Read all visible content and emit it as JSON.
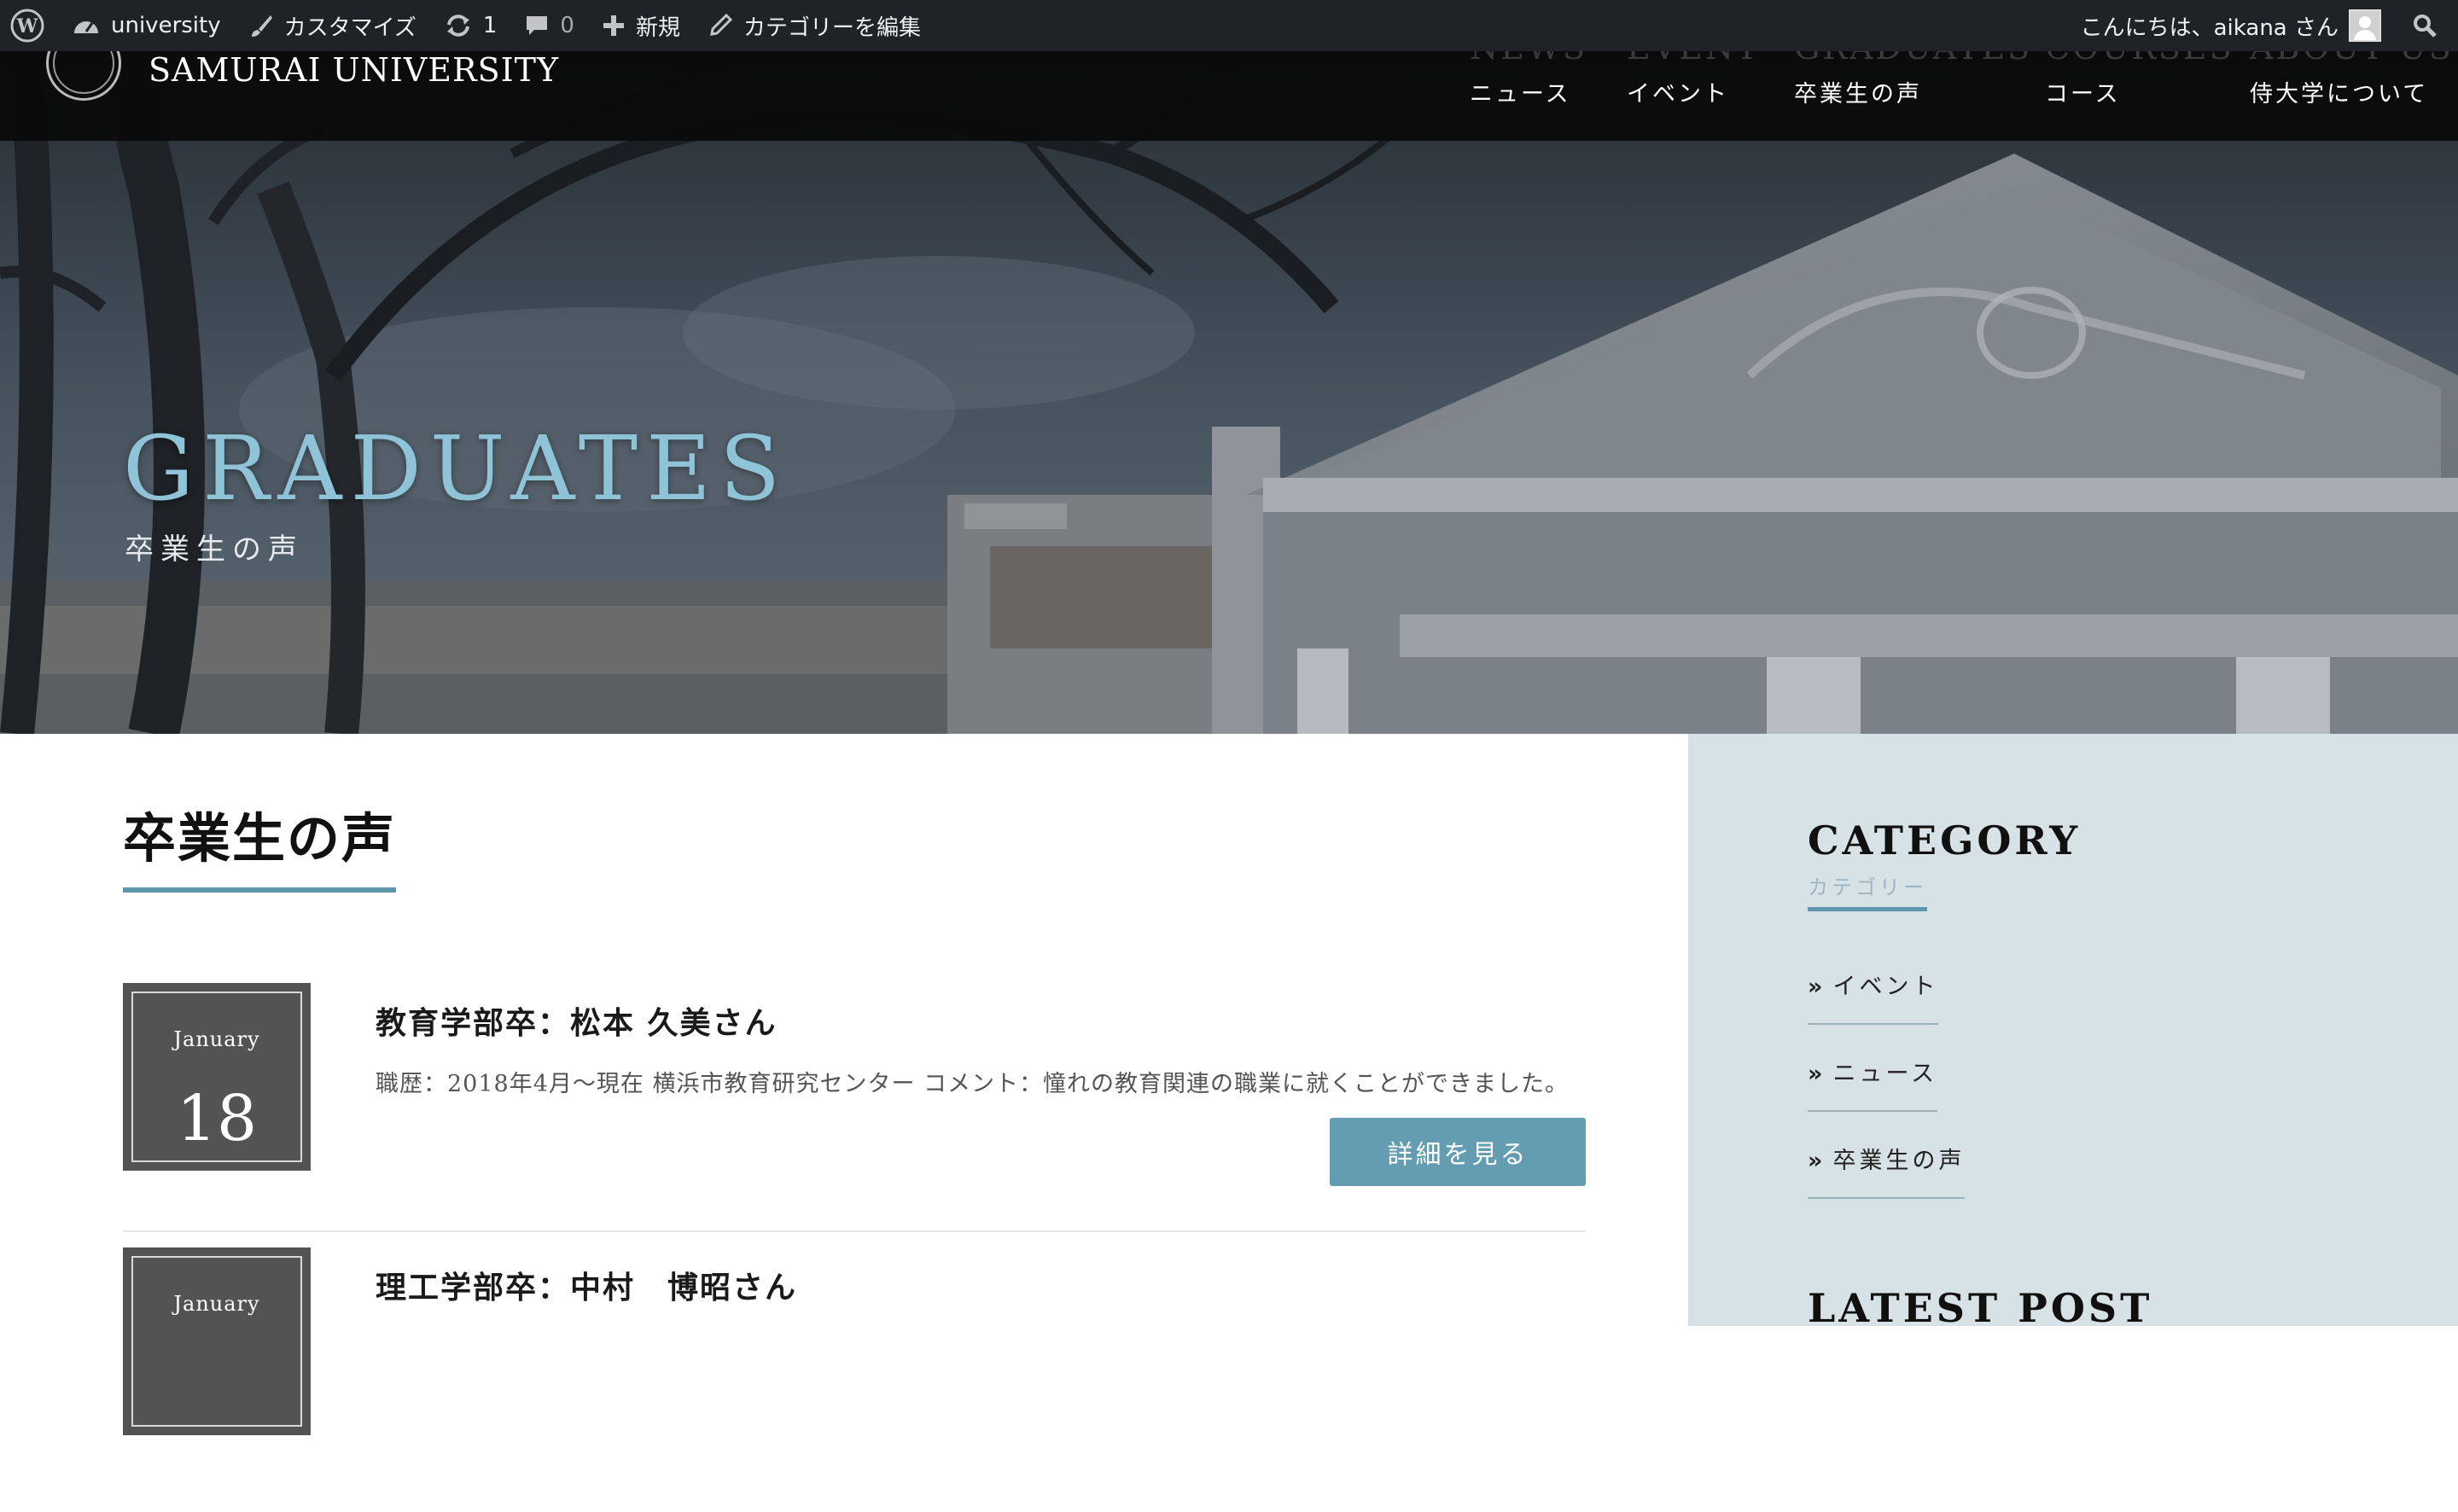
{
  "admin_bar": {
    "site_name": "university",
    "customize": "カスタマイズ",
    "updates_count": "1",
    "comments_count": "0",
    "new_label": "新規",
    "edit_category": "カテゴリーを編集",
    "greeting": "こんにちは、aikana さん"
  },
  "header": {
    "site_title": "SAMURAI UNIVERSITY",
    "nav": [
      {
        "en": "NEWS",
        "jp": "ニュース"
      },
      {
        "en": "EVENT",
        "jp": "イベント"
      },
      {
        "en": "GRADUATES",
        "jp": "卒業生の声"
      },
      {
        "en": "COURSES",
        "jp": "コース"
      },
      {
        "en": "ABOUT US",
        "jp": "侍大学について"
      }
    ]
  },
  "hero": {
    "title": "GRADUATES",
    "subtitle": "卒業生の声"
  },
  "main": {
    "heading": "卒業生の声",
    "posts": [
      {
        "month": "January",
        "day": "18",
        "title": "教育学部卒：松本 久美さん",
        "excerpt": "職歴：2018年4月〜現在 横浜市教育研究センター コメント：憧れの教育関連の職業に就くことができました。",
        "more_label": "詳細を見る"
      },
      {
        "month": "January",
        "title": "理工学部卒：中村　博昭さん"
      }
    ]
  },
  "sidebar": {
    "category_heading": "CATEGORY",
    "category_sub": "カテゴリー",
    "categories": [
      "イベント",
      "ニュース",
      "卒業生の声"
    ],
    "latest_heading": "LATEST POST"
  },
  "colors": {
    "accent": "#5e97ad",
    "button": "#649db2",
    "hero_title": "#8fc4d8",
    "sidebar_bg": "#d7e2e7",
    "admin_bar": "#1d2327"
  }
}
